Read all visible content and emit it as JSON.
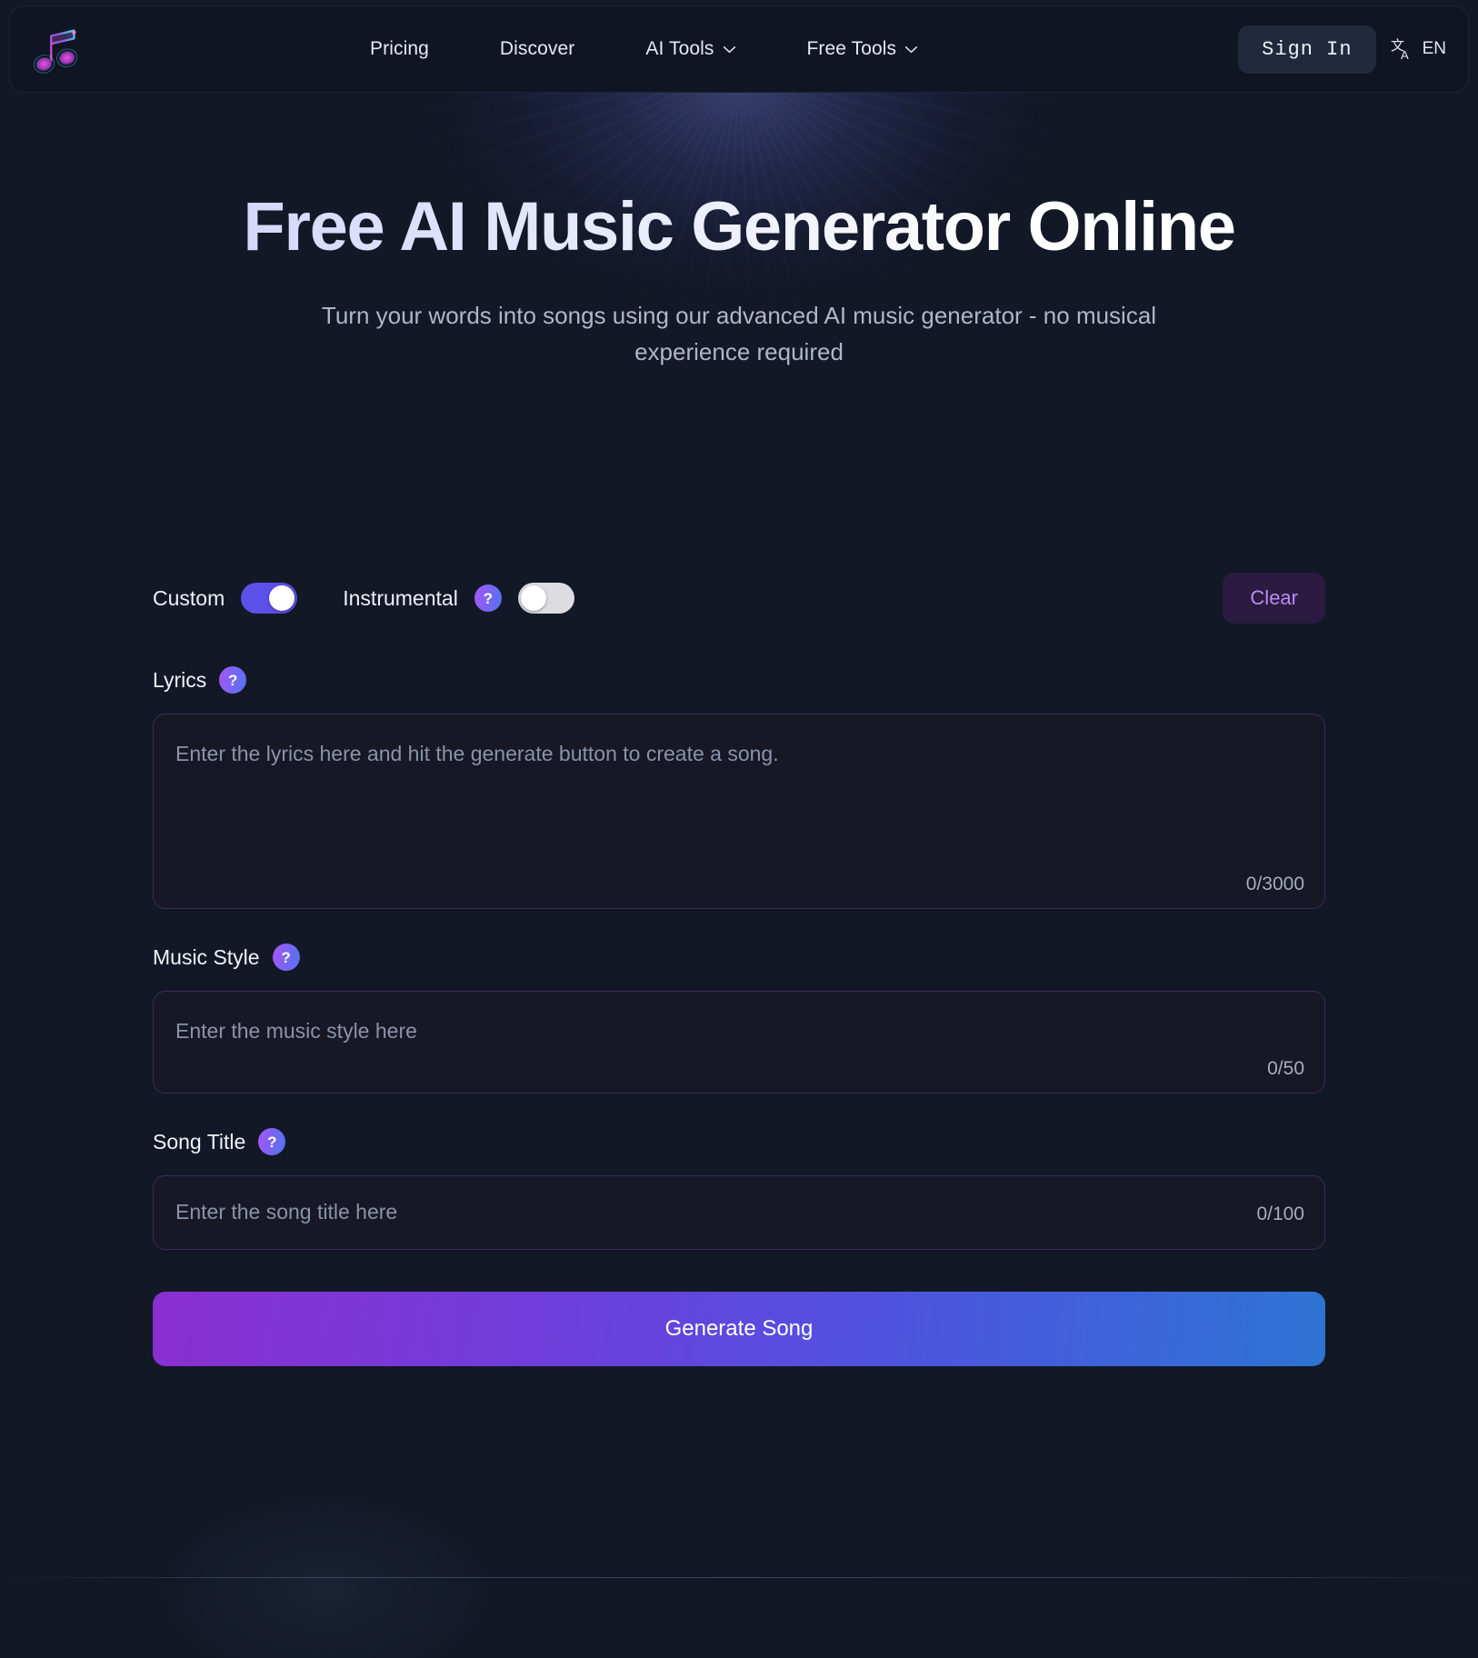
{
  "brand": {
    "logo_icon": "music-note-logo"
  },
  "header": {
    "nav": [
      {
        "label": "Pricing",
        "has_chevron": false
      },
      {
        "label": "Discover",
        "has_chevron": false
      },
      {
        "label": "AI Tools",
        "has_chevron": true
      },
      {
        "label": "Free Tools",
        "has_chevron": true
      }
    ],
    "sign_in_label": "Sign In",
    "language": {
      "icon": "translate-icon",
      "code": "EN"
    }
  },
  "hero": {
    "title": "Free AI Music Generator Online",
    "subtitle": "Turn your words into songs using our advanced AI music generator - no musical experience required"
  },
  "form": {
    "custom": {
      "label": "Custom",
      "state": "on"
    },
    "instrumental": {
      "label": "Instrumental",
      "state": "off",
      "help": "?"
    },
    "clear_label": "Clear",
    "lyrics": {
      "label": "Lyrics",
      "help": "?",
      "value": "",
      "placeholder": "Enter the lyrics here and hit the generate button to create a song.",
      "counter": "0/3000"
    },
    "music_style": {
      "label": "Music Style",
      "help": "?",
      "value": "",
      "placeholder": "Enter the music style here",
      "counter": "0/50"
    },
    "song_title": {
      "label": "Song Title",
      "help": "?",
      "value": "",
      "placeholder": "Enter the song title here",
      "counter": "0/100"
    },
    "generate_label": "Generate Song"
  },
  "colors": {
    "page_bg": "#121826",
    "header_bg": "#0f1522",
    "accent_purple": "#a855f7",
    "accent_blue": "#2d74d4",
    "toggle_on": "#5b50e8",
    "toggle_off": "#dcdce2",
    "clear_bg": "#2b1b40",
    "clear_text": "#b98cf5",
    "input_bg": "#171726",
    "input_border": "#3a2d55",
    "placeholder_text": "#8b93a8"
  }
}
